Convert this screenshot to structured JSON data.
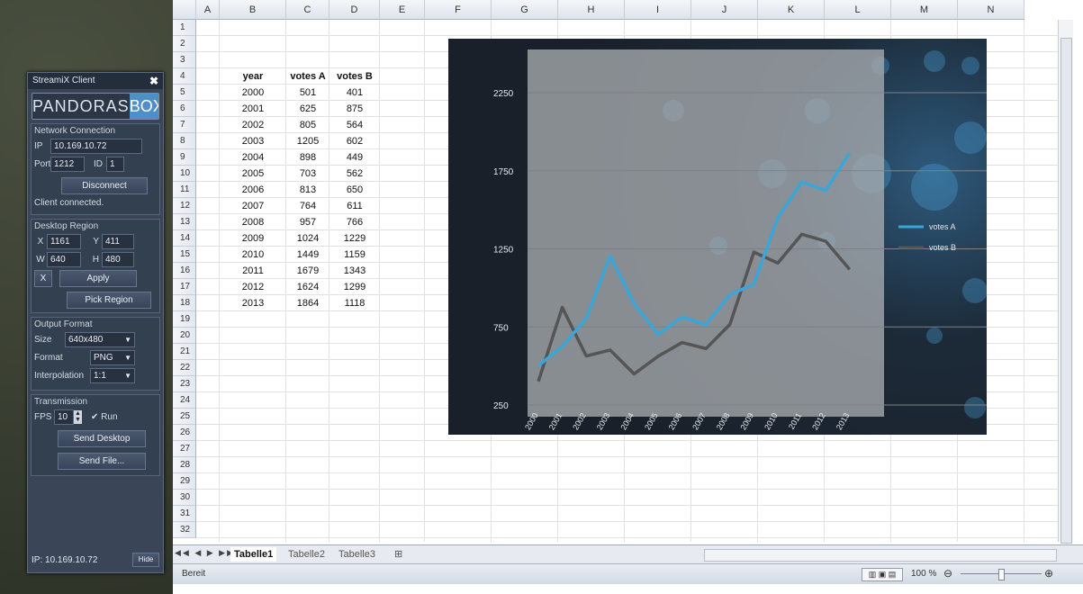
{
  "panel": {
    "title": "StreamiX Client",
    "logo_left": "PANDORAS",
    "logo_right": "BOX",
    "network": {
      "title": "Network Connection",
      "ip_label": "IP",
      "ip_value": "10.169.10.72",
      "port_label": "Port",
      "port_value": "1212",
      "id_label": "ID",
      "id_value": "1",
      "disconnect": "Disconnect",
      "status": "Client connected."
    },
    "region": {
      "title": "Desktop Region",
      "x_label": "X",
      "x_value": "1161",
      "y_label": "Y",
      "y_value": "411",
      "w_label": "W",
      "w_value": "640",
      "h_label": "H",
      "h_value": "480",
      "x_button": "X",
      "apply": "Apply",
      "pick": "Pick Region"
    },
    "output": {
      "title": "Output Format",
      "size_label": "Size",
      "size_value": "640x480",
      "format_label": "Format",
      "format_value": "PNG",
      "interp_label": "Interpolation",
      "interp_value": "1:1"
    },
    "transmission": {
      "title": "Transmission",
      "fps_label": "FPS",
      "fps_value": "10",
      "run_label": "✔ Run",
      "send_desktop": "Send Desktop",
      "send_file": "Send File..."
    },
    "footer_ip": "IP: 10.169.10.72",
    "hide": "Hide"
  },
  "excel": {
    "columns": [
      "A",
      "B",
      "C",
      "D",
      "E",
      "F",
      "G",
      "H",
      "I",
      "J",
      "K",
      "L",
      "M",
      "N"
    ],
    "rows": [
      "1",
      "2",
      "3",
      "4",
      "5",
      "6",
      "7",
      "8",
      "9",
      "10",
      "11",
      "12",
      "13",
      "14",
      "15",
      "16",
      "17",
      "18",
      "19",
      "20",
      "21",
      "22",
      "23",
      "24",
      "25",
      "26",
      "27",
      "28",
      "29",
      "30",
      "31",
      "32"
    ],
    "table_headers": [
      "year",
      "votes A",
      "votes B"
    ],
    "table": [
      [
        "2000",
        "501",
        "401"
      ],
      [
        "2001",
        "625",
        "875"
      ],
      [
        "2002",
        "805",
        "564"
      ],
      [
        "2003",
        "1205",
        "602"
      ],
      [
        "2004",
        "898",
        "449"
      ],
      [
        "2005",
        "703",
        "562"
      ],
      [
        "2006",
        "813",
        "650"
      ],
      [
        "2007",
        "764",
        "611"
      ],
      [
        "2008",
        "957",
        "766"
      ],
      [
        "2009",
        "1024",
        "1229"
      ],
      [
        "2010",
        "1449",
        "1159"
      ],
      [
        "2011",
        "1679",
        "1343"
      ],
      [
        "2012",
        "1624",
        "1299"
      ],
      [
        "2013",
        "1864",
        "1118"
      ]
    ],
    "sheet_tabs": [
      "Tabelle1",
      "Tabelle2",
      "Tabelle3"
    ],
    "tab_nav": "◀◀ ◀ ▶ ▶▶",
    "status": "Bereit",
    "zoom": "100 %"
  },
  "colors": {
    "votes_a": "#3aa6d8",
    "votes_b": "#555555"
  },
  "chart_data": {
    "type": "line",
    "categories": [
      "2000",
      "2001",
      "2002",
      "2003",
      "2004",
      "2005",
      "2006",
      "2007",
      "2008",
      "2009",
      "2010",
      "2011",
      "2012",
      "2013"
    ],
    "series": [
      {
        "name": "votes A",
        "values": [
          501,
          625,
          805,
          1205,
          898,
          703,
          813,
          764,
          957,
          1024,
          1449,
          1679,
          1624,
          1864
        ]
      },
      {
        "name": "votes B",
        "values": [
          401,
          875,
          564,
          602,
          449,
          562,
          650,
          611,
          766,
          1229,
          1159,
          1343,
          1299,
          1118
        ]
      }
    ],
    "yticks": [
      "250",
      "750",
      "1250",
      "1750",
      "2250"
    ],
    "ylim": [
      250,
      2250
    ],
    "grid": true,
    "legend": "right"
  }
}
